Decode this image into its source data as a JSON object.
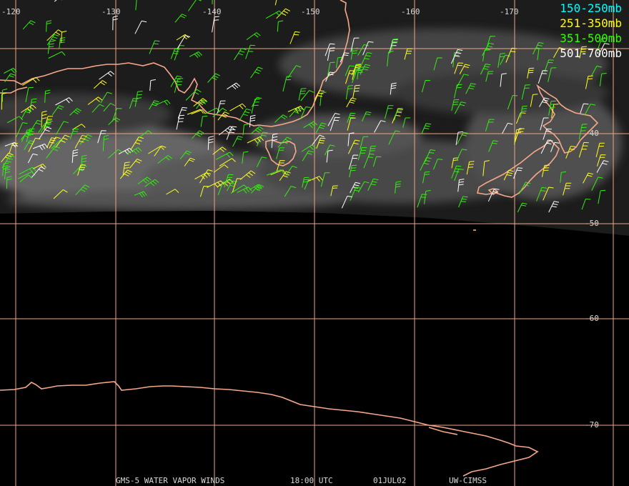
{
  "map": {
    "longitude_labels": [
      "-120",
      "-130",
      "-140",
      "-150",
      "-160",
      "-170"
    ],
    "latitude_labels": [
      "-40",
      "-50",
      "-60",
      "-70"
    ],
    "grid_color": "#f0a483",
    "coast_color": "#f7a88a",
    "legend": [
      {
        "label": "150-250mb",
        "color": "#00ffff"
      },
      {
        "label": "251-350mb",
        "color": "#ffff00"
      },
      {
        "label": "351-500mb",
        "color": "#33ff00"
      },
      {
        "label": "501-700mb",
        "color": "#ffffff"
      }
    ],
    "footer": {
      "product": "GMS-5 WATER VAPOR WINDS",
      "time": "18:00 UTC",
      "date": "01JUL02",
      "source": "UW-CIMSS"
    }
  }
}
